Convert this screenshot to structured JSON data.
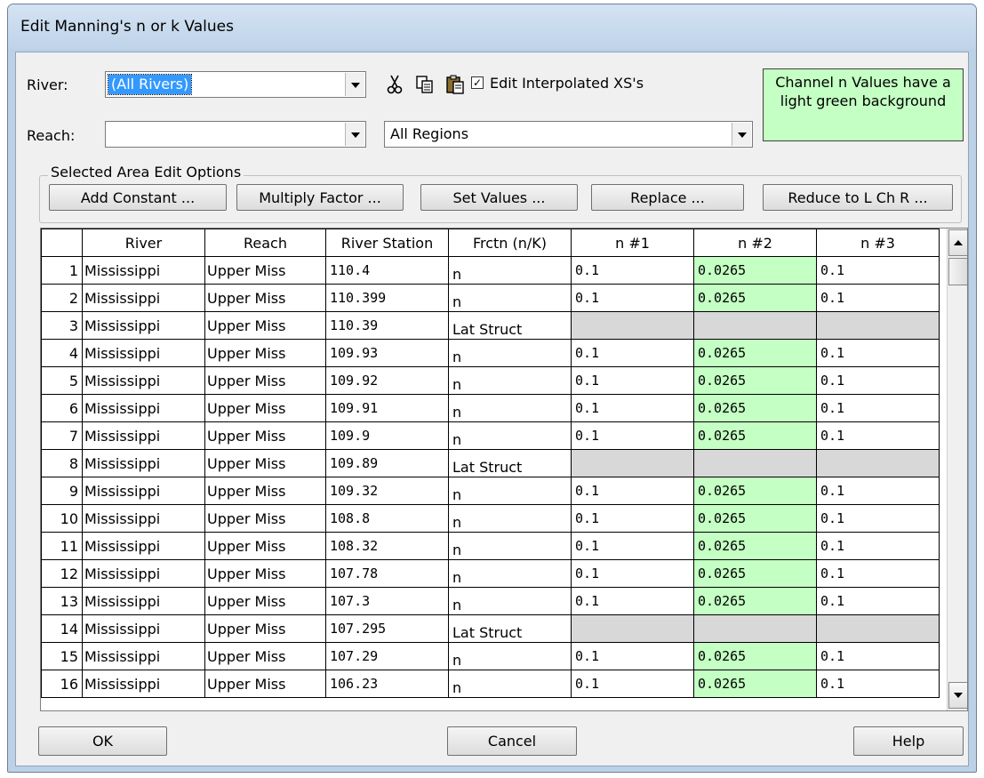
{
  "window": {
    "title": "Edit Manning's n or k Values"
  },
  "top": {
    "river_label": "River:",
    "river_value": "(All Rivers)",
    "reach_label": "Reach:",
    "reach_value": "",
    "region_value": "All Regions",
    "edit_interpolated_label": "Edit Interpolated XS's",
    "edit_interpolated_checked": true,
    "note": "Channel n Values have a light green background",
    "note_color": "#c4ffc4",
    "tools": [
      "scissors-icon",
      "copy-icon",
      "paste-icon"
    ]
  },
  "edit_options": {
    "group_label": "Selected Area Edit Options",
    "add_constant": "Add Constant ...",
    "multiply_factor": "Multiply Factor ...",
    "set_values": "Set Values ...",
    "replace": "Replace ...",
    "reduce": "Reduce to L Ch R ..."
  },
  "grid": {
    "columns": [
      "",
      "River",
      "Reach",
      "River Station",
      "Frctn (n/K)",
      "n #1",
      "n #2",
      "n #3"
    ],
    "rows": [
      {
        "num": "1",
        "river": "Mississippi",
        "reach": "Upper Miss",
        "station": "110.4",
        "frctn": "n",
        "n1": "0.1",
        "n2": "0.0265",
        "n3": "0.1"
      },
      {
        "num": "2",
        "river": "Mississippi",
        "reach": "Upper Miss",
        "station": "110.399",
        "frctn": "n",
        "n1": "0.1",
        "n2": "0.0265",
        "n3": "0.1"
      },
      {
        "num": "3",
        "river": "Mississippi",
        "reach": "Upper Miss",
        "station": "110.39",
        "frctn": "Lat Struct",
        "n1": "",
        "n2": "",
        "n3": ""
      },
      {
        "num": "4",
        "river": "Mississippi",
        "reach": "Upper Miss",
        "station": "109.93",
        "frctn": "n",
        "n1": "0.1",
        "n2": "0.0265",
        "n3": "0.1"
      },
      {
        "num": "5",
        "river": "Mississippi",
        "reach": "Upper Miss",
        "station": "109.92",
        "frctn": "n",
        "n1": "0.1",
        "n2": "0.0265",
        "n3": "0.1"
      },
      {
        "num": "6",
        "river": "Mississippi",
        "reach": "Upper Miss",
        "station": "109.91",
        "frctn": "n",
        "n1": "0.1",
        "n2": "0.0265",
        "n3": "0.1"
      },
      {
        "num": "7",
        "river": "Mississippi",
        "reach": "Upper Miss",
        "station": "109.9",
        "frctn": "n",
        "n1": "0.1",
        "n2": "0.0265",
        "n3": "0.1"
      },
      {
        "num": "8",
        "river": "Mississippi",
        "reach": "Upper Miss",
        "station": "109.89",
        "frctn": "Lat Struct",
        "n1": "",
        "n2": "",
        "n3": ""
      },
      {
        "num": "9",
        "river": "Mississippi",
        "reach": "Upper Miss",
        "station": "109.32",
        "frctn": "n",
        "n1": "0.1",
        "n2": "0.0265",
        "n3": "0.1"
      },
      {
        "num": "10",
        "river": "Mississippi",
        "reach": "Upper Miss",
        "station": "108.8",
        "frctn": "n",
        "n1": "0.1",
        "n2": "0.0265",
        "n3": "0.1"
      },
      {
        "num": "11",
        "river": "Mississippi",
        "reach": "Upper Miss",
        "station": "108.32",
        "frctn": "n",
        "n1": "0.1",
        "n2": "0.0265",
        "n3": "0.1"
      },
      {
        "num": "12",
        "river": "Mississippi",
        "reach": "Upper Miss",
        "station": "107.78",
        "frctn": "n",
        "n1": "0.1",
        "n2": "0.0265",
        "n3": "0.1"
      },
      {
        "num": "13",
        "river": "Mississippi",
        "reach": "Upper Miss",
        "station": "107.3",
        "frctn": "n",
        "n1": "0.1",
        "n2": "0.0265",
        "n3": "0.1"
      },
      {
        "num": "14",
        "river": "Mississippi",
        "reach": "Upper Miss",
        "station": "107.295",
        "frctn": "Lat Struct",
        "n1": "",
        "n2": "",
        "n3": ""
      },
      {
        "num": "15",
        "river": "Mississippi",
        "reach": "Upper Miss",
        "station": "107.29",
        "frctn": "n",
        "n1": "0.1",
        "n2": "0.0265",
        "n3": "0.1"
      },
      {
        "num": "16",
        "river": "Mississippi",
        "reach": "Upper Miss",
        "station": "106.23",
        "frctn": "n",
        "n1": "0.1",
        "n2": "0.0265",
        "n3": "0.1"
      }
    ]
  },
  "footer": {
    "ok": "OK",
    "cancel": "Cancel",
    "help": "Help"
  }
}
